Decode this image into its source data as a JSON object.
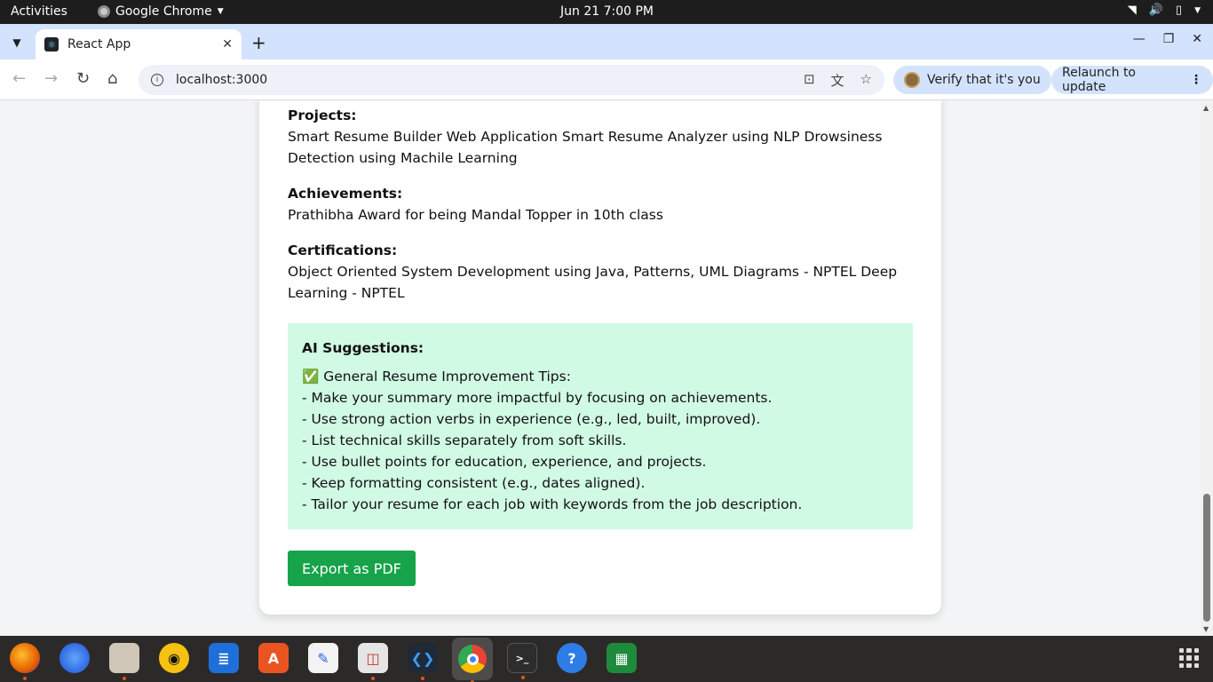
{
  "system_bar": {
    "activities": "Activities",
    "app_name": "Google Chrome",
    "clock": "Jun 21  7:00 PM"
  },
  "browser": {
    "tab_title": "React App",
    "url": "localhost:3000",
    "verify_label": "Verify that it's you",
    "relaunch_label": "Relaunch to update"
  },
  "resume": {
    "projects": {
      "heading": "Projects:",
      "text": "Smart Resume Builder Web Application Smart Resume Analyzer using NLP Drowsiness Detection using Machile Learning"
    },
    "achievements": {
      "heading": "Achievements:",
      "text": "Prathibha Award for being Mandal Topper in 10th class"
    },
    "certifications": {
      "heading": "Certifications:",
      "text": "Object Oriented System Development using Java, Patterns, UML Diagrams - NPTEL Deep Learning - NPTEL"
    }
  },
  "ai_suggestions": {
    "title": "AI Suggestions:",
    "lines": [
      "✅ General Resume Improvement Tips:",
      "- Make your summary more impactful by focusing on achievements.",
      "- Use strong action verbs in experience (e.g., led, built, improved).",
      "- List technical skills separately from soft skills.",
      "- Use bullet points for education, experience, and projects.",
      "- Keep formatting consistent (e.g., dates aligned).",
      "- Tailor your resume for each job with keywords from the job description."
    ]
  },
  "actions": {
    "export_label": "Export as PDF"
  },
  "dock": {
    "apps": [
      "firefox-icon",
      "thunderbird-icon",
      "files-icon",
      "rhythmbox-icon",
      "writer-icon",
      "app-center-icon",
      "text-editor-icon",
      "document-viewer-icon",
      "vscode-icon",
      "chrome-icon",
      "terminal-icon",
      "help-icon",
      "calc-icon"
    ]
  },
  "colors": {
    "accent_green": "#16a34a",
    "suggestion_bg": "#d1fae5",
    "tabstrip_bg": "#d3e3fd"
  }
}
